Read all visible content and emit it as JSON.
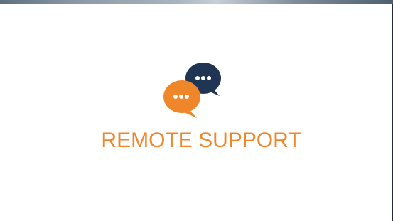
{
  "screen": {
    "title": "REMOTE SUPPORT",
    "icon": "chat-bubbles-icon"
  },
  "colors": {
    "accent": "#f0862a",
    "navy": "#1f3553",
    "background": "#ffffff"
  }
}
